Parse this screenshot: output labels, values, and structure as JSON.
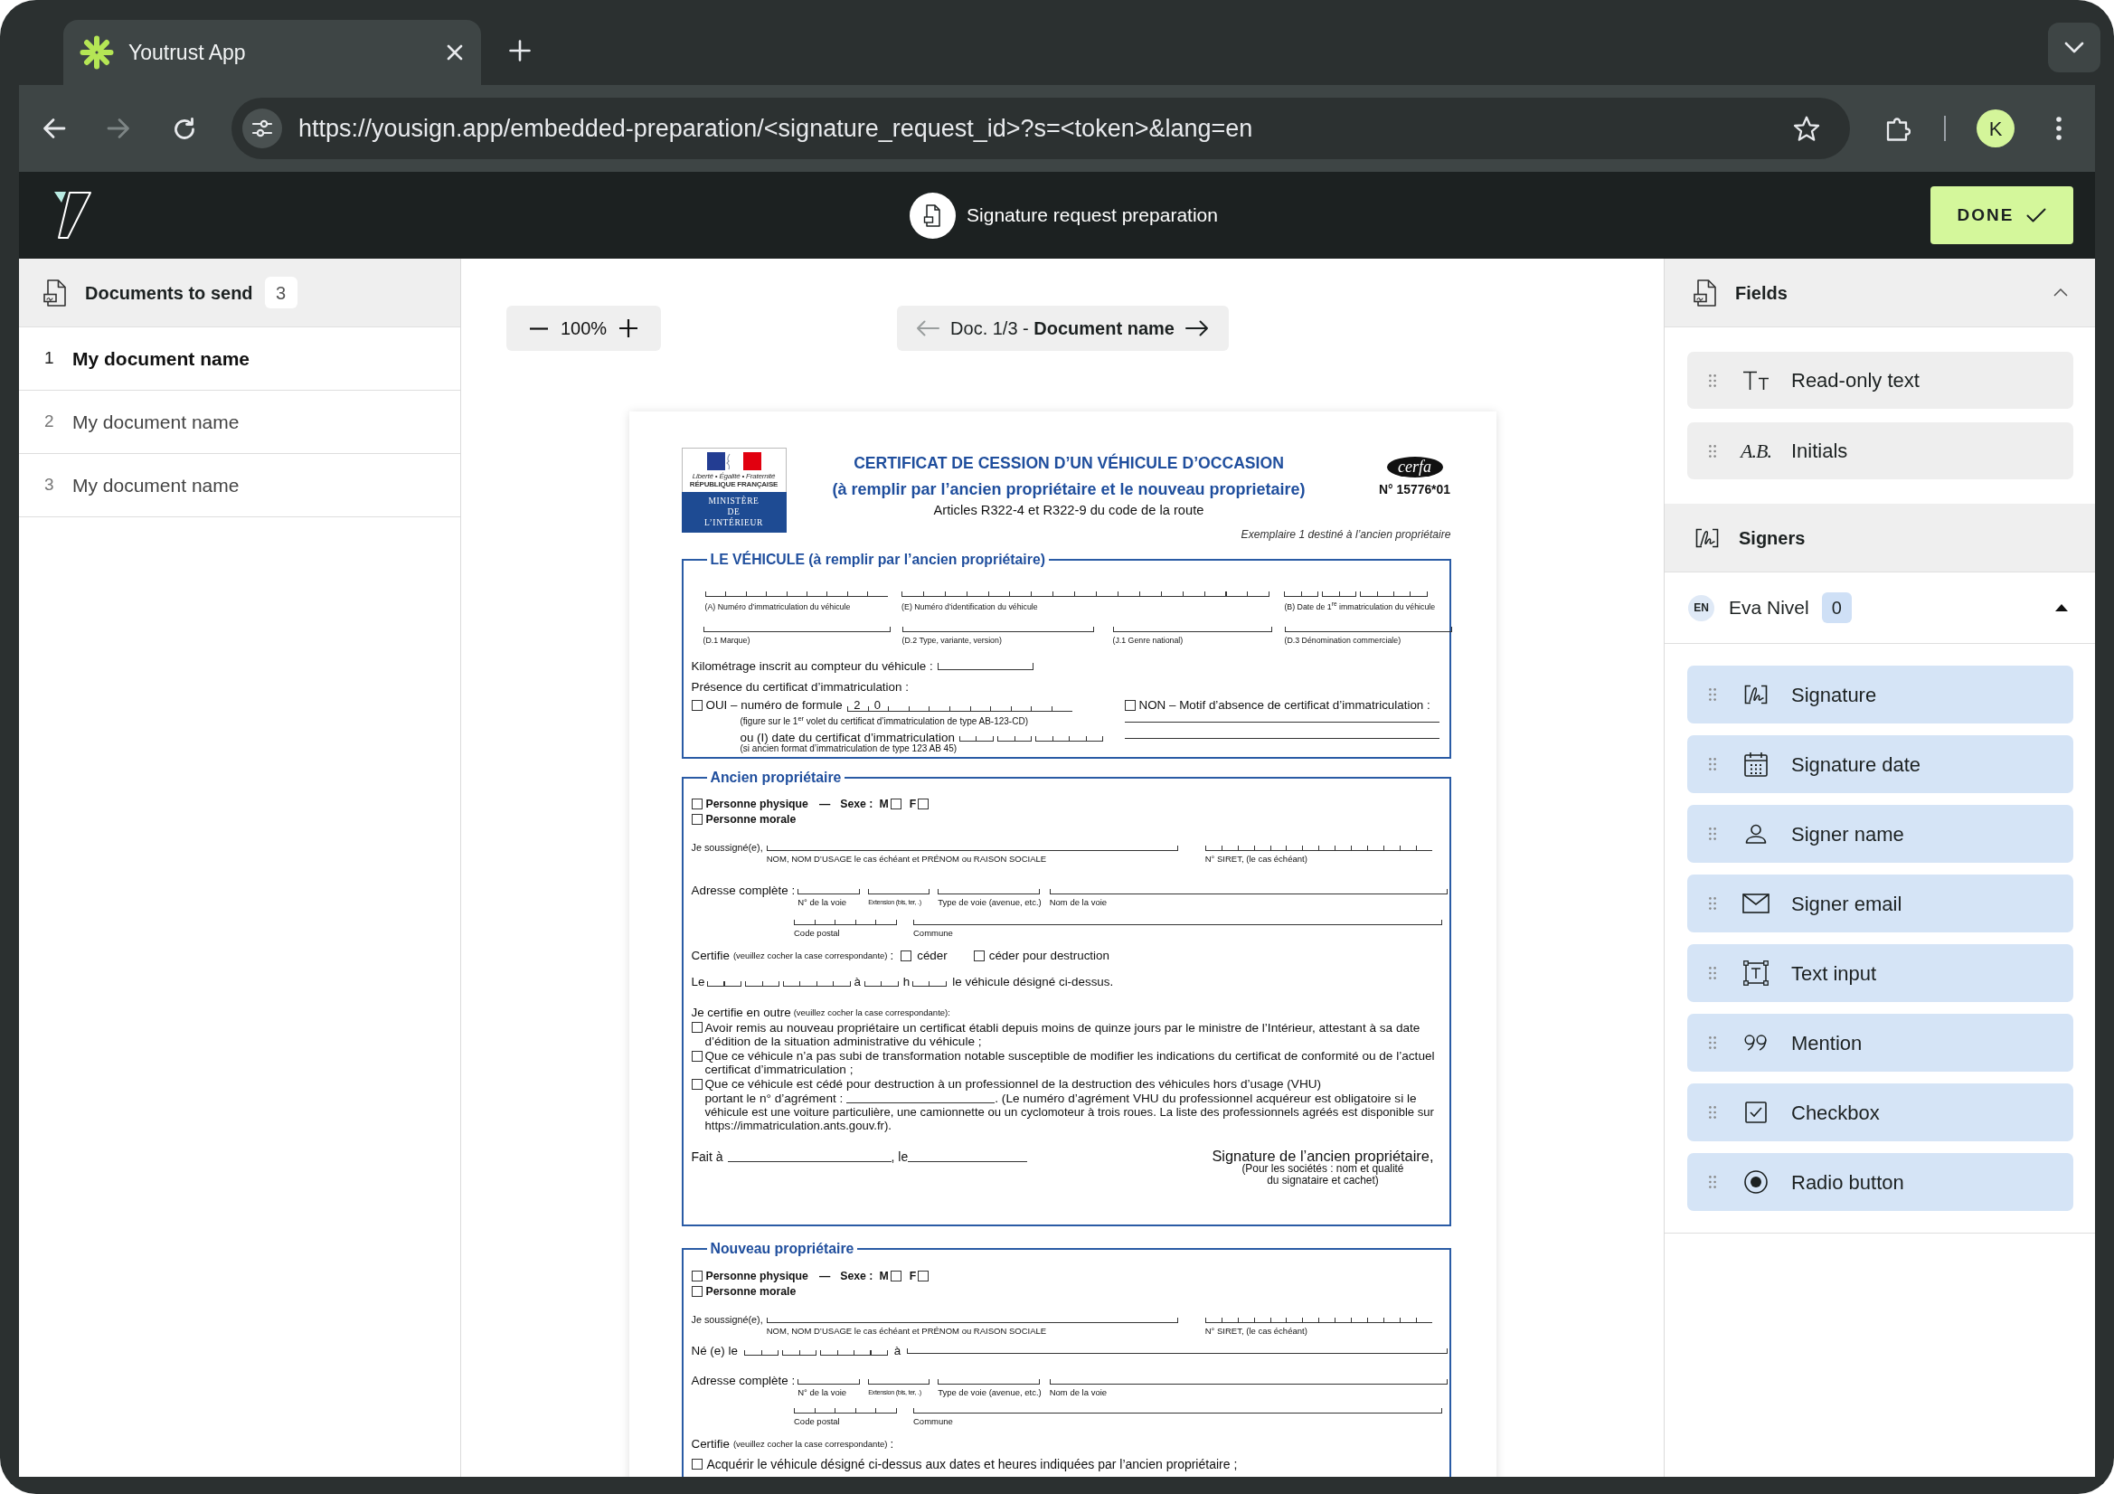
{
  "browser": {
    "tab": {
      "title": "Youtrust App",
      "selected": true
    },
    "forward_disabled": true,
    "url": "https://yousign.app/embedded-preparation/<signature_request_id>?s=<token>&lang=en",
    "profile_initial": "K"
  },
  "app_header": {
    "title": "Signature request preparation",
    "done_button": "DONE"
  },
  "documents_panel": {
    "title": "Documents to send",
    "count": "3",
    "items": [
      {
        "number": "1",
        "name": "My document name",
        "selected": true
      },
      {
        "number": "2",
        "name": "My document name",
        "selected": false
      },
      {
        "number": "3",
        "name": "My document name",
        "selected": false
      }
    ]
  },
  "viewer": {
    "zoom": "100%",
    "document_nav": "Doc. 1/3 - **Document name**",
    "previous_disabled": true,
    "next_disabled": false,
    "document_page": {
      "motto": "Liberté • Égalité • Fraternité",
      "republic": "RÉPUBLIQUE FRANÇAISE",
      "ministry": "MINISTÈRE DE L’INTÉRIEUR",
      "title": "CERTIFICAT DE CESSION D’UN VÉHICULE D’OCCASION",
      "subtitle": "(à remplir par l’ancien propriétaire et le nouveau proprietaire)",
      "legal_basis": "Articles R322-4 et R322-9 du code de la route",
      "form_logo": "cerfa",
      "form_number": "N° 15776*01",
      "copy_note": "Exemplaire 1 destiné à l’ancien propriétaire",
      "vehicle": {
        "title": "LE VÉHICULE (à remplir par l’ancien propriétaire)",
        "identifiers": [
          "(A) Numéro d’immatriculation du véhicule",
          "(E) Numéro d’identification du véhicule",
          "(B) Date de 1$^{re}$ immatriculation du véhicule"
        ],
        "details": [
          "(D.1 Marque)",
          "(D.2 Type, variante, version)",
          "(J.1 Genre national)",
          "(D.3 Dénomination commerciale)"
        ],
        "mileage": "Kilométrage inscrit au compteur du véhicule :",
        "certificate": "Présence du certificat d’immatriculation :",
        "yes": {
          "label": "OUI – numéro de formule",
          "checked": false,
          "prefilled": [
            "2",
            "0"
          ],
          "note": "(figure sur le 1$^{er}$ volet du certificat d’immatriculation de type AB-123-CD)",
          "date_label": "ou (I) date du certificat d’immatriculation",
          "date_note": "(si ancien format d’immatriculation de type 123 AB 45)"
        },
        "no": {
          "label": "NON – Motif d’absence de certificat d’immatriculation :",
          "checked": false
        }
      },
      "former_owner": {
        "title": "Ancien propriétaire",
        "natural_person": {
          "label": "Personne physique",
          "checked": false
        },
        "separator": "—",
        "sex": "Sexe :",
        "sex_options": [
          {
            "label": "M",
            "checked": false
          },
          {
            "label": "F",
            "checked": false
          }
        ],
        "legal_person": {
          "label": "Personne morale",
          "checked": false
        },
        "undersigned": "Je soussigné(e),",
        "name_hint": "NOM, NOM D’USAGE le cas échéant et PRÉNOM ou RAISON SOCIALE",
        "siret_hint": "N° SIRET, (le cas échéant)",
        "address": "Adresse complète :",
        "address_hints": [
          "N° de la voie",
          "Extension (bis, ter, .)",
          "Type de voie (avenue, etc.)",
          "Nom de la voie"
        ],
        "locality_hints": [
          "Code postal",
          "Commune"
        ],
        "certifies": {
          "label": "Certifie",
          "hint": "(veuillez cocher la case correspondante)",
          "suffix": ":"
        },
        "transfer_options": [
          {
            "label": "céder",
            "checked": false
          },
          {
            "label": "céder pour destruction",
            "checked": false
          }
        ],
        "transfer_date": {
          "before": "Le",
          "at": "à",
          "hour": "h",
          "after": "le véhicule désigné ci-dessus."
        },
        "also_certifies": {
          "label": "Je certifie en outre",
          "hint": "(veuillez cocher la case correspondante):"
        },
        "statements": [
          {
            "text": "Avoir remis au nouveau propriétaire un certificat établi depuis moins de quinze jours par le ministre de l’Intérieur, attestant à sa date d’édition de la situation administrative du véhicule ;",
            "checked": false
          },
          {
            "text": "Que ce véhicule n’a pas subi de transformation notable susceptible de modifier les indications du certificat de conformité ou de l’actuel certificat d’immatriculation ;",
            "checked": false
          },
          {
            "text": "Que ce véhicule est cédé pour destruction à un professionnel de la destruction des véhicules hors d’usage (VHU)",
            "checked": false,
            "blank_before": "portant le n° d’agrément :",
            "blank_after": ". (Le numéro d’agrément VHU du professionnel acquéreur est obligatoire si le",
            "continuation": "véhicule est une voiture particulière, une camionnette ou un cyclomoteur à trois roues. La liste des professionnels agréés est disponible sur https://immatriculation.ants.gouv.fr)."
          }
        ],
        "place": "Fait à",
        "date": ", le",
        "signature": "Signature de l’ancien propriétaire,",
        "signature_hint": "(Pour les sociétés : nom et qualité du signataire et cachet)"
      },
      "new_owner": {
        "title": "Nouveau propriétaire",
        "natural_person": {
          "label": "Personne physique",
          "checked": false
        },
        "separator": "—",
        "sex": "Sexe :",
        "sex_options": [
          {
            "label": "M",
            "checked": false
          },
          {
            "label": "F",
            "checked": false
          }
        ],
        "legal_person": {
          "label": "Personne morale",
          "checked": false
        },
        "undersigned": "Je soussigné(e),",
        "name_hint": "NOM, NOM D’USAGE le cas échéant et PRÉNOM ou RAISON SOCIALE",
        "siret_hint": "N° SIRET, (le cas échéant)",
        "birth": {
          "label": "Né (e) le",
          "at": "à"
        },
        "address": "Adresse complète :",
        "address_hints": [
          "N° de la voie",
          "Extension (bis, ter, .)",
          "Type de voie (avenue, etc.)",
          "Nom de la voie"
        ],
        "locality_hints": [
          "Code postal",
          "Commune"
        ],
        "certifies": {
          "label": "Certifie",
          "hint": "(veuillez cocher la case correspondante)",
          "suffix": ":"
        },
        "statements": [
          {
            "text": "Acquérir le véhicule désigné ci-dessus aux dates et heures indiquées par l’ancien propriétaire ;",
            "checked": false
          }
        ]
      }
    }
  },
  "fields_panel": {
    "title": "Fields",
    "expanded": true,
    "items": [
      {
        "kind": "read-only-text",
        "label": "Read-only text"
      },
      {
        "kind": "initials",
        "label": "Initials",
        "glyph": "A.B."
      }
    ]
  },
  "signers_panel": {
    "title": "Signers",
    "signer": {
      "initials": "EN",
      "name": "Eva Nivel",
      "count": "0",
      "expanded": true
    },
    "items": [
      {
        "kind": "signature",
        "label": "Signature"
      },
      {
        "kind": "date",
        "label": "Signature date"
      },
      {
        "kind": "name",
        "label": "Signer name"
      },
      {
        "kind": "email",
        "label": "Signer email"
      },
      {
        "kind": "text-input",
        "label": "Text input"
      },
      {
        "kind": "mention",
        "label": "Mention"
      },
      {
        "kind": "checkbox",
        "label": "Checkbox"
      },
      {
        "kind": "radio",
        "label": "Radio button"
      }
    ]
  }
}
